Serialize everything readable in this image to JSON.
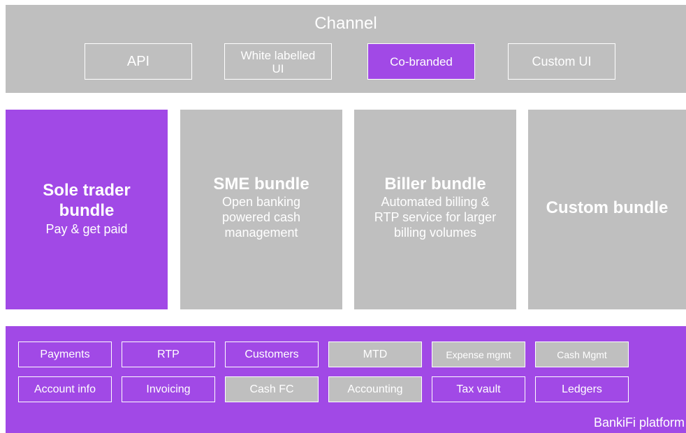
{
  "colors": {
    "purple": "#a149e6",
    "gray": "#bfbfbf",
    "white": "#ffffff"
  },
  "channel": {
    "title": "Channel",
    "options": [
      {
        "label": "API",
        "selected": false
      },
      {
        "line1": "White labelled",
        "line2": "UI",
        "selected": false
      },
      {
        "label": "Co-branded",
        "selected": true
      },
      {
        "label": "Custom UI",
        "selected": false
      }
    ]
  },
  "bundles": [
    {
      "title_line1": "Sole trader",
      "title_line2": "bundle",
      "desc": "Pay & get paid",
      "highlighted": true
    },
    {
      "title": "SME bundle",
      "desc_line1": "Open banking",
      "desc_line2": "powered cash",
      "desc_line3": "management",
      "highlighted": false
    },
    {
      "title": "Biller bundle",
      "desc_line1": "Automated billing &",
      "desc_line2": "RTP service for larger",
      "desc_line3": "billing volumes",
      "highlighted": false
    },
    {
      "title": "Custom bundle",
      "highlighted": false
    }
  ],
  "platform": {
    "label": "BankiFi platform",
    "row1": [
      {
        "label": "Payments",
        "included": true
      },
      {
        "label": "RTP",
        "included": true
      },
      {
        "label": "Customers",
        "included": true
      },
      {
        "label": "MTD",
        "included": false
      },
      {
        "label": "Expense mgmt",
        "included": false
      },
      {
        "label": "Cash Mgmt",
        "included": false
      }
    ],
    "row2": [
      {
        "label": "Account info",
        "included": true
      },
      {
        "label": "Invoicing",
        "included": true
      },
      {
        "label": "Cash FC",
        "included": false
      },
      {
        "label": "Accounting",
        "included": false
      },
      {
        "label": "Tax vault",
        "included": true
      },
      {
        "label": "Ledgers",
        "included": true
      }
    ]
  }
}
